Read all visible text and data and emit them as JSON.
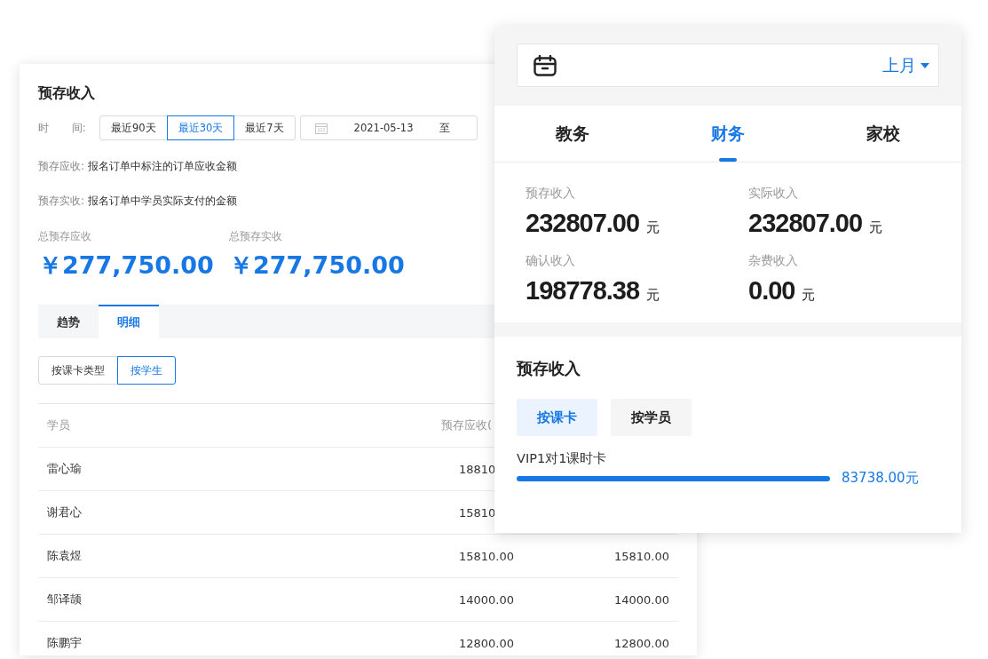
{
  "desktop": {
    "title": "预存收入",
    "time_label": "时 间:",
    "ranges": [
      {
        "label": "最近90天",
        "selected": false
      },
      {
        "label": "最近30天",
        "selected": true
      },
      {
        "label": "最近7天",
        "selected": false
      }
    ],
    "date_range": {
      "start": "2021-05-13",
      "separator": "至"
    },
    "definitions": [
      {
        "term": "预存应收:",
        "text": "报名订单中标注的订单应收金额"
      },
      {
        "term": "预存实收:",
        "text": "报名订单中学员实际支付的金额"
      }
    ],
    "totals": [
      {
        "label": "总预存应收",
        "value": "￥277,750.00"
      },
      {
        "label": "总预存实收",
        "value": "￥277,750.00"
      }
    ],
    "tabs": [
      {
        "label": "趋势",
        "selected": false
      },
      {
        "label": "明细",
        "selected": true
      }
    ],
    "group_by": [
      {
        "label": "按课卡类型",
        "selected": false
      },
      {
        "label": "按学生",
        "selected": true
      }
    ],
    "table": {
      "columns": [
        "学员",
        "预存应收("
      ],
      "rows": [
        {
          "cells": [
            "雷心瑜",
            "18810"
          ]
        },
        {
          "cells": [
            "谢君心",
            "15810"
          ]
        },
        {
          "cells": [
            "陈袁煜",
            "15810.00",
            "15810.00"
          ]
        },
        {
          "cells": [
            "邹译颉",
            "14000.00",
            "14000.00"
          ]
        },
        {
          "cells": [
            "陈鹏宇",
            "12800.00",
            "12800.00"
          ]
        }
      ]
    }
  },
  "mobile": {
    "period": "上月",
    "tabs": [
      {
        "label": "教务",
        "selected": false
      },
      {
        "label": "财务",
        "selected": true
      },
      {
        "label": "家校",
        "selected": false
      }
    ],
    "stats": [
      {
        "label": "预存收入",
        "value": "232807.00",
        "unit": "元"
      },
      {
        "label": "实际收入",
        "value": "232807.00",
        "unit": "元"
      },
      {
        "label": "确认收入",
        "value": "198778.38",
        "unit": "元"
      },
      {
        "label": "杂费收入",
        "value": "0.00",
        "unit": "元"
      }
    ],
    "section": {
      "title": "预存收入",
      "modes": [
        {
          "label": "按课卡",
          "selected": true
        },
        {
          "label": "按学员",
          "selected": false
        }
      ],
      "items": [
        {
          "name": "VIP1对1课时卡",
          "level": 1,
          "value": "83738.00元"
        }
      ]
    }
  }
}
